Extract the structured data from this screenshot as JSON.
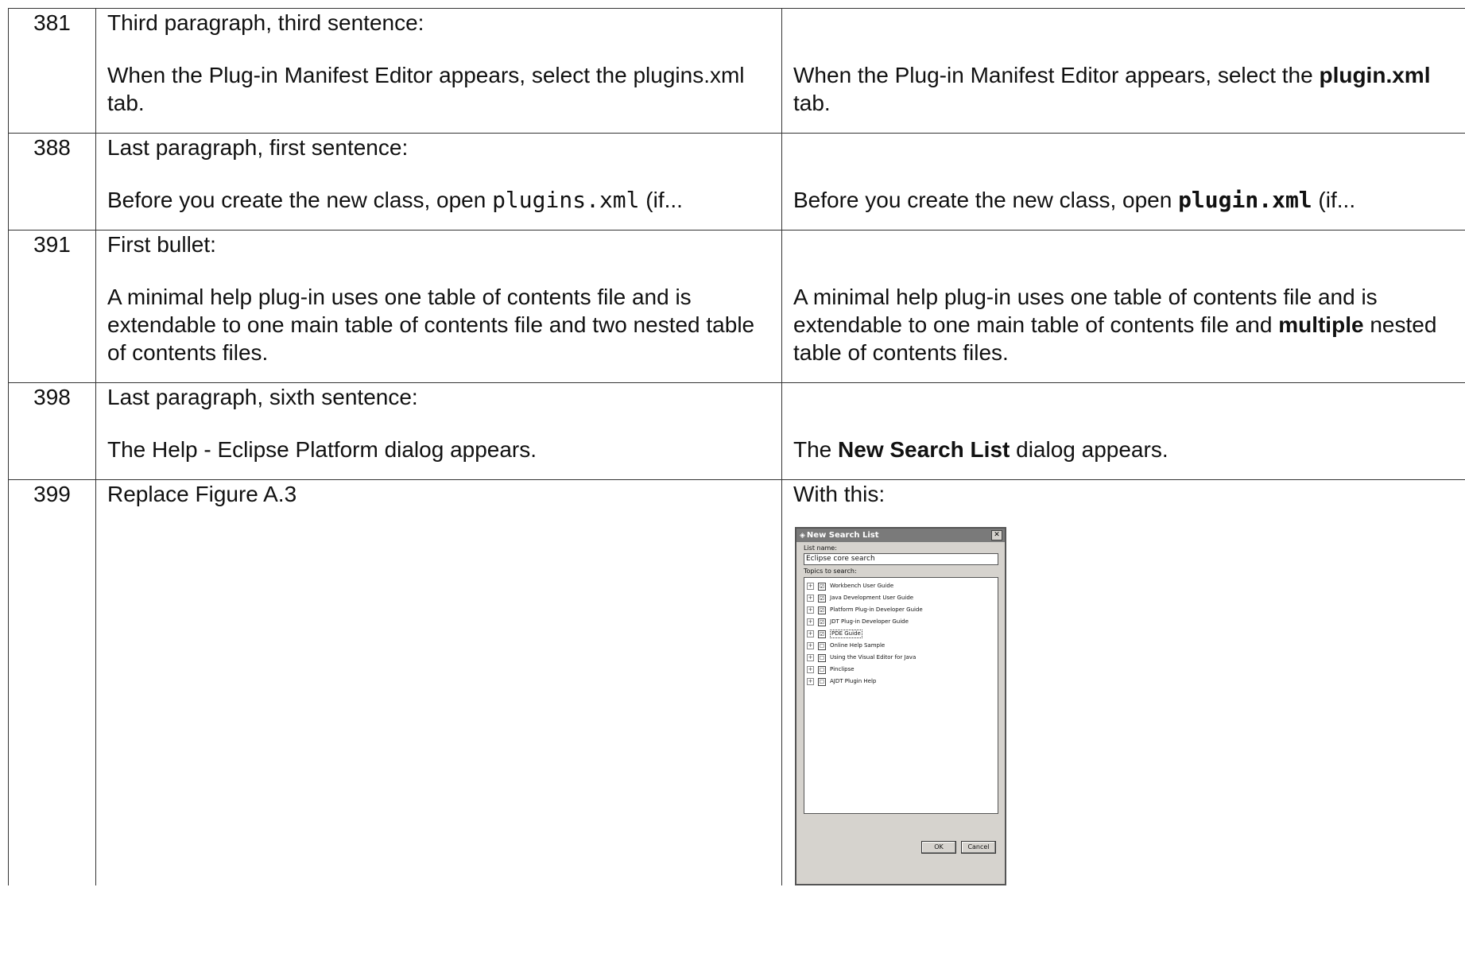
{
  "rows": [
    {
      "page": "381",
      "location": "Third paragraph, third sentence:",
      "old": "When the Plug-in Manifest Editor appears, select the plugins.xml tab.",
      "new_pre": "When the Plug-in Manifest Editor appears, select the ",
      "new_bold": "plugin.xml",
      "new_post": " tab."
    },
    {
      "page": "388",
      "location": "Last paragraph, first sentence:",
      "old_pre": "Before you create the new class, open ",
      "old_code": "plugins.xml",
      "old_post": " (if...",
      "new_pre": "Before you create the new class, open ",
      "new_code": "plugin.xml",
      "new_post": " (if..."
    },
    {
      "page": "391",
      "location": "First bullet:",
      "old": "A minimal help plug-in uses one table of contents file and is extendable to one main table of contents file and two nested table of contents files.",
      "new_pre": "A minimal help plug-in uses one table of contents file and is extendable to one main table of contents file and ",
      "new_bold": "multiple",
      "new_post": " nested table of contents files."
    },
    {
      "page": "398",
      "location": "Last paragraph, sixth sentence:",
      "old": "The Help - Eclipse Platform dialog appears.",
      "new_pre": "The ",
      "new_bold": "New Search List",
      "new_post": " dialog appears."
    },
    {
      "page": "399",
      "old": "Replace Figure A.3",
      "new": "With this:"
    }
  ],
  "dialog": {
    "title": "New Search List",
    "close_label": "✕",
    "list_name_label": "List name:",
    "list_name_value": "Eclipse core search",
    "topics_label": "Topics to search:",
    "topics": [
      {
        "label": "Workbench User Guide",
        "checked": "☑"
      },
      {
        "label": "Java Development User Guide",
        "checked": "☑"
      },
      {
        "label": "Platform Plug-in Developer Guide",
        "checked": "☑"
      },
      {
        "label": "JDT Plug-in Developer Guide",
        "checked": "☑"
      },
      {
        "label": "PDE Guide",
        "checked": "☑"
      },
      {
        "label": "Online Help Sample",
        "checked": "☐"
      },
      {
        "label": "Using the Visual Editor for Java",
        "checked": "☐"
      },
      {
        "label": "Pinclipse",
        "checked": "☐"
      },
      {
        "label": "AJDT Plugin Help",
        "checked": "☐"
      }
    ],
    "ok_label": "OK",
    "cancel_label": "Cancel"
  }
}
